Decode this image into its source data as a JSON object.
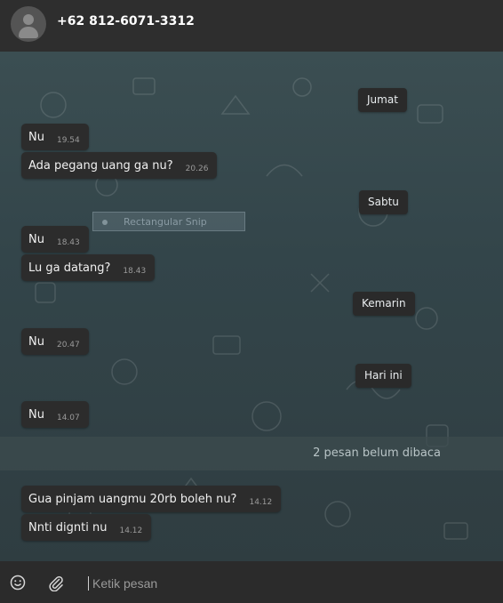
{
  "header": {
    "contact_name": "+62 812-6071-3312"
  },
  "chat": {
    "date_chips": [
      "Jumat",
      "Sabtu",
      "Kemarin",
      "Hari ini"
    ],
    "messages": [
      {
        "text": "Nu",
        "time": "19.54"
      },
      {
        "text": "Ada pegang uang ga nu?",
        "time": "20.26"
      },
      {
        "text": "Nu",
        "time": "18.43"
      },
      {
        "text": "Lu ga datang?",
        "time": "18.43"
      },
      {
        "text": "Nu",
        "time": "20.47"
      },
      {
        "text": "Nu",
        "time": "14.07"
      },
      {
        "text": "Gua pinjam uangmu 20rb boleh nu?",
        "time": "14.12"
      },
      {
        "text": "Nnti dignti nu",
        "time": "14.12"
      }
    ],
    "unread_banner": "2 pesan belum dibaca",
    "overlay_label": "Rectangular Snip"
  },
  "composer": {
    "placeholder": "Ketik pesan",
    "emoji_icon": "emoji-icon",
    "attach_icon": "paperclip-icon"
  }
}
